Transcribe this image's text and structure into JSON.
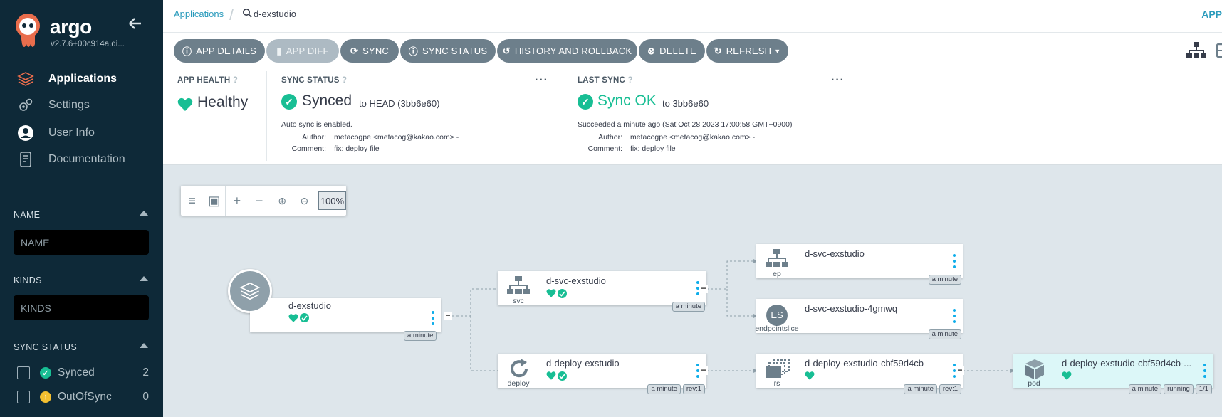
{
  "sidebar": {
    "brand": "argo",
    "version": "v2.7.6+00c914a.di...",
    "nav": [
      {
        "label": "Applications",
        "icon": "layers-icon"
      },
      {
        "label": "Settings",
        "icon": "gears-icon"
      },
      {
        "label": "User Info",
        "icon": "user-circle-icon"
      },
      {
        "label": "Documentation",
        "icon": "book-icon"
      }
    ],
    "filters": {
      "name_title": "NAME",
      "name_placeholder": "NAME",
      "kinds_title": "KINDS",
      "kinds_placeholder": "KINDS",
      "sync_status_title": "SYNC STATUS",
      "sync_statuses": [
        {
          "label": "Synced",
          "count": "2",
          "color": "#18be94"
        },
        {
          "label": "OutOfSync",
          "count": "0",
          "color": "#f4c030"
        }
      ]
    }
  },
  "topbar": {
    "breadcrumb_root": "Applications",
    "breadcrumb_current": "d-exstudio",
    "right_text": "APP"
  },
  "toolbar": {
    "buttons": [
      {
        "label": "APP DETAILS",
        "icon": "info-icon",
        "disabled": false
      },
      {
        "label": "APP DIFF",
        "icon": "file-icon",
        "disabled": true
      },
      {
        "label": "SYNC",
        "icon": "sync-icon",
        "disabled": false
      },
      {
        "label": "SYNC STATUS",
        "icon": "info-icon",
        "disabled": false
      },
      {
        "label": "HISTORY AND ROLLBACK",
        "icon": "history-icon",
        "disabled": false
      },
      {
        "label": "DELETE",
        "icon": "times-circle-icon",
        "disabled": false
      },
      {
        "label": "REFRESH",
        "icon": "redo-icon",
        "disabled": false
      }
    ]
  },
  "status": {
    "health": {
      "title": "APP HEALTH",
      "value": "Healthy",
      "color": "#18be94"
    },
    "sync": {
      "title": "SYNC STATUS",
      "value": "Synced",
      "to": "to HEAD (3bb6e60)",
      "auto": "Auto sync is enabled.",
      "author_key": "Author:",
      "author": "metacogpe <metacog@kakao.com> -",
      "comment_key": "Comment:",
      "comment": "fix: deploy file"
    },
    "last_sync": {
      "title": "LAST SYNC",
      "value": "Sync OK",
      "to": "to 3bb6e60",
      "succeeded": "Succeeded a minute ago (Sat Oct 28 2023 17:00:58 GMT+0900)",
      "author_key": "Author:",
      "author": "metacogpe <metacog@kakao.com> -",
      "comment_key": "Comment:",
      "comment": "fix: deploy file"
    }
  },
  "canvas": {
    "zoom": "100%",
    "nodes": {
      "app": {
        "name": "d-exstudio",
        "tags": [
          "a minute"
        ]
      },
      "svc": {
        "kind": "svc",
        "name": "d-svc-exstudio",
        "tags": [
          "a minute"
        ]
      },
      "deploy": {
        "kind": "deploy",
        "name": "d-deploy-exstudio",
        "tags": [
          "a minute",
          "rev:1"
        ]
      },
      "ep": {
        "kind": "ep",
        "name": "d-svc-exstudio",
        "tags": [
          "a minute"
        ]
      },
      "eps": {
        "kind": "endpointslice",
        "name": "d-svc-exstudio-4gmwq",
        "badge": "ES",
        "tags": [
          "a minute"
        ]
      },
      "rs": {
        "kind": "rs",
        "name": "d-deploy-exstudio-cbf59d4cb",
        "tags": [
          "a minute",
          "rev:1"
        ]
      },
      "pod": {
        "kind": "pod",
        "name": "d-deploy-exstudio-cbf59d4cb-...",
        "tags": [
          "a minute",
          "running",
          "1/1"
        ]
      }
    }
  },
  "colors": {
    "accent": "#2a9bbc",
    "healthy": "#18be94",
    "sidebar": "#0e2938",
    "button": "#6d7f8b"
  }
}
